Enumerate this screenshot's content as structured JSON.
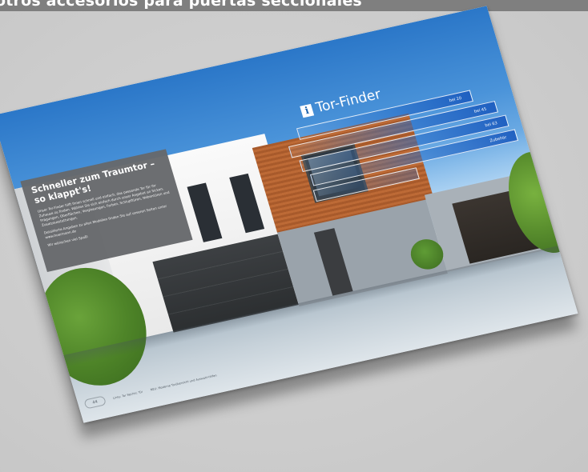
{
  "banner": {
    "title": "otros accesorios para puertas seccionales"
  },
  "brochure": {
    "info_panel": {
      "title_line1": "Schneller zum Traumtor –",
      "title_line2": "so klappt's!",
      "body": "Unser Tor-Finder hilft Ihnen schnell und einfach, das passende Tor für Ihr Zuhause zu finden. Wählen Sie sich einfach durch unser Angebot an Sicken, Prägungen, Oberflächen, Verglasungen, Farben, Schlupftüren, Nebentüren und Zusatzausstattungen.",
      "body2": "Detaillierte Angaben zu allen Modellen finden Sie auf unseren Seiten unter www.hoermann.de",
      "foot": "Wir wünschen viel Spaß!"
    },
    "finder": {
      "icon_glyph": "i",
      "title": "Tor-Finder",
      "bars": [
        {
          "label": "bei 20"
        },
        {
          "label": "bei 45"
        },
        {
          "label": "bei 63"
        },
        {
          "label": "Zubehör"
        },
        {
          "label": ""
        }
      ]
    },
    "footer": {
      "page_number": "44",
      "col1": "Links: Tor Rechts: Tür",
      "col2": "NEU: Moderne Torübersicht und Auswahl-Hilfen"
    }
  },
  "colors": {
    "banner_bg": "#7f7f7f",
    "background": "#d3d3d3",
    "sky": "#2b77c8",
    "panel": "#66686b",
    "wood": "#a85a2b"
  }
}
